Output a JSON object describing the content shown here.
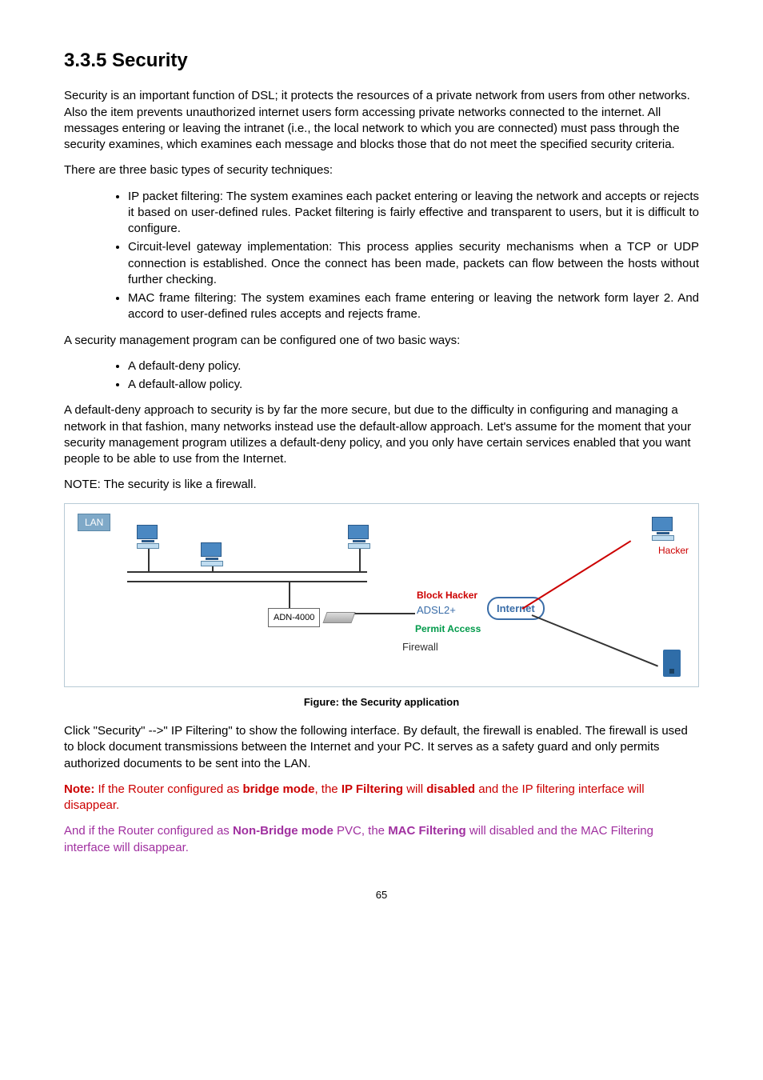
{
  "heading": "3.3.5 Security",
  "para1": "Security is an important function of DSL; it protects the resources of a private network from users from other networks. Also the item prevents unauthorized internet users form accessing private networks connected to the internet. All messages entering or leaving the intranet (i.e., the local network to which you are connected) must pass through the security examines, which examines each message and blocks those that do not meet the specified security criteria.",
  "para2": "There are three basic types of security techniques:",
  "bullets1": [
    "IP packet filtering: The system examines each packet entering or leaving the network and accepts or rejects it based on user-defined rules. Packet filtering is fairly effective and transparent to users, but it is difficult to configure.",
    "Circuit-level gateway implementation: This process applies security mechanisms when a TCP or UDP connection is established. Once the connect has been made, packets can flow between the hosts without further checking.",
    "MAC frame filtering: The system examines each frame entering or leaving the network form layer 2. And accord to user-defined rules accepts and rejects frame."
  ],
  "para3": "A security management program can be configured one of two basic ways:",
  "bullets2": [
    "A default-deny policy.",
    "A default-allow policy."
  ],
  "para4": "A default-deny approach to security is by far the more secure, but due to the difficulty in configuring and managing a network in that fashion, many networks instead use the default-allow approach. Let's assume for the moment that your security management program utilizes a default-deny policy, and you only have certain services enabled that you want people to be able to use from the Internet.",
  "para5": "NOTE: The security is like a firewall.",
  "caption": "Figure: the Security application",
  "para6": "Click \"Security\" -->\" IP Filtering\" to show the following interface. By default, the firewall is enabled. The firewall is used to block document transmissions between the Internet and your PC. It serves as a safety guard and only permits authorized documents to be sent into the LAN.",
  "note1_prefix": "Note:",
  "note1_a": " If the Router configured as ",
  "note1_b1": "bridge mode",
  "note1_c": ", the ",
  "note1_b2": "IP Filtering",
  "note1_d": " will ",
  "note1_b3": "disabled",
  "note1_e": " and the IP filtering interface will disappear.",
  "note2_a": "And if the Router configured as ",
  "note2_b1": "Non-Bridge mode",
  "note2_c": " PVC, the ",
  "note2_b2": "MAC Filtering",
  "note2_d": " will disabled and the MAC Filtering interface will disappear.",
  "diagram": {
    "lan": "LAN",
    "hacker": "Hacker",
    "modem": "ADN-4000",
    "block": "Block Hacker",
    "adsl": "ADSL2+",
    "internet": "Internet",
    "permit": "Permit Access",
    "firewall": "Firewall"
  },
  "page_number": "65"
}
